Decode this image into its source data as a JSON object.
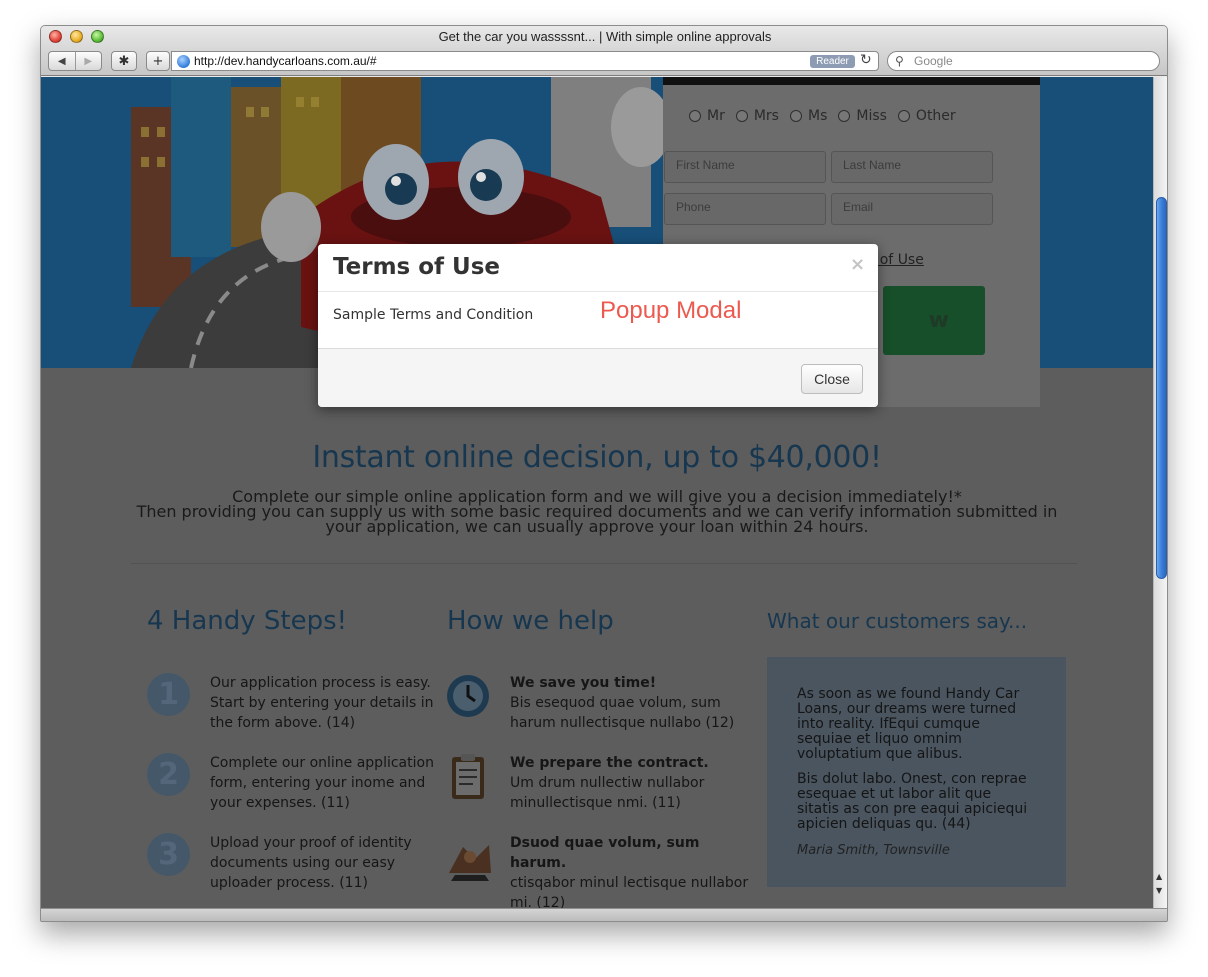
{
  "window": {
    "title": "Get the car you wassssnt... | With simple online approvals"
  },
  "toolbar": {
    "back_icon": "back-arrow-icon",
    "forward_icon": "forward-arrow-icon",
    "url": "http://dev.handycarloans.com.au/#",
    "reader_label": "Reader",
    "search_placeholder": "Google"
  },
  "form": {
    "titles": [
      "Mr",
      "Mrs",
      "Ms",
      "Miss",
      "Other"
    ],
    "first_name_placeholder": "First Name",
    "last_name_placeholder": "Last Name",
    "phone_placeholder": "Phone",
    "email_placeholder": "Email",
    "terms_link_visible": "s of Use",
    "apply_visible": "w"
  },
  "hero_text": {
    "headline": "Instant online decision, up to $40,000!",
    "intro_line1": "Complete our simple online application form and we will give you a decision immediately!*",
    "intro_line2": "Then providing you can supply us with some basic required documents and we can verify information submitted in your application, we can usually approve your loan within 24 hours."
  },
  "steps": {
    "title": "4 Handy Steps!",
    "items": [
      {
        "num": "1",
        "text": "Our application process is easy. Start by entering your details in the form above. (14)"
      },
      {
        "num": "2",
        "text": "Complete our online application form, entering your inome and your expenses. (11)"
      },
      {
        "num": "3",
        "text": "Upload your proof of identity documents using our easy uploader process. (11)"
      }
    ]
  },
  "help": {
    "title": "How we help",
    "items": [
      {
        "icon": "clock-icon",
        "title": "We save you time!",
        "text": "Bis esequod quae volum, sum harum nullectisque nullabo (12)"
      },
      {
        "icon": "clipboard-icon",
        "title": "We prepare the contract.",
        "text": "Um drum nullectiw nullabor minullectisque nmi. (11)"
      },
      {
        "icon": "handshake-icon",
        "title": "Dsuod quae volum, sum harum.",
        "text": "ctisqabor minul lectisque nullabor mi. (12)"
      }
    ]
  },
  "testimonials": {
    "title": "What our customers say...",
    "para1": "As soon as we found Handy Car Loans, our dreams were turned into reality. IfEqui cumque sequiae et liquo omnim voluptatium que alibus.",
    "para2": "Bis dolut labo. Onest, con repraе esequae et ut labor alit que sitatis as con pre eaqui apiciequi apicien deliquas qu. (44)",
    "author": "Maria Smith, Townsville"
  },
  "modal": {
    "title": "Terms of Use",
    "close_x": "×",
    "body": "Sample Terms and Condition",
    "close_button": "Close"
  },
  "annotation": {
    "label": "Popup Modal",
    "color": "#ec5a4f"
  },
  "colors": {
    "hero_blue": "#174f79",
    "heading_blue": "#173750",
    "overlay_gray": "#5d5d5d"
  }
}
